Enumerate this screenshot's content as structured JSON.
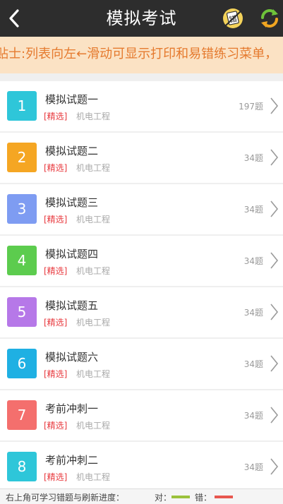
{
  "header": {
    "title": "模拟考试",
    "wrong_icon_text": "错"
  },
  "tip": {
    "text": "贴士:列表向左←滑动可显示打印和易错练习菜单，"
  },
  "items": [
    {
      "number": "1",
      "name": "模拟试题一",
      "tag": "[精选]",
      "category": "机电工程",
      "count": "197题",
      "color": "#2ec6d9"
    },
    {
      "number": "2",
      "name": "模拟试题二",
      "tag": "[精选]",
      "category": "机电工程",
      "count": "34题",
      "color": "#f5a623"
    },
    {
      "number": "3",
      "name": "模拟试题三",
      "tag": "[精选]",
      "category": "机电工程",
      "count": "34题",
      "color": "#7e9cf2"
    },
    {
      "number": "4",
      "name": "模拟试题四",
      "tag": "[精选]",
      "category": "机电工程",
      "count": "34题",
      "color": "#5ccc4e"
    },
    {
      "number": "5",
      "name": "模拟试题五",
      "tag": "[精选]",
      "category": "机电工程",
      "count": "34题",
      "color": "#b678e8"
    },
    {
      "number": "6",
      "name": "模拟试题六",
      "tag": "[精选]",
      "category": "机电工程",
      "count": "34题",
      "color": "#1fb0e3"
    },
    {
      "number": "7",
      "name": "考前冲刺一",
      "tag": "[精选]",
      "category": "机电工程",
      "count": "34题",
      "color": "#f46f6d"
    },
    {
      "number": "8",
      "name": "考前冲刺二",
      "tag": "[精选]",
      "category": "机电工程",
      "count": "34题",
      "color": "#2ec6d9"
    }
  ],
  "footer": {
    "hint": "右上角可学习错题与刷新进度：",
    "right_label": "对：",
    "wrong_label": "错：",
    "right_color": "#9bc23c",
    "wrong_color": "#e8574f"
  }
}
